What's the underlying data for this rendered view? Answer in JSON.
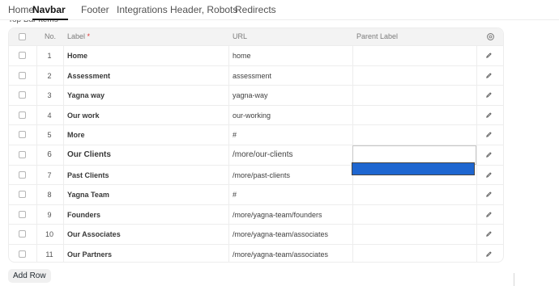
{
  "tabs": [
    {
      "label": "Home"
    },
    {
      "label": "Navbar",
      "active": true
    },
    {
      "label": "Footer"
    },
    {
      "label": "Integrations"
    },
    {
      "label": "Header, Robots"
    },
    {
      "label": "Redirects"
    }
  ],
  "section_label": "Top Bar Items",
  "columns": {
    "no": "No.",
    "label": "Label",
    "required_mark": "*",
    "url": "URL",
    "parent_label": "Parent Label"
  },
  "rows": [
    {
      "no": "1",
      "label": "Home",
      "url": "home",
      "parent": ""
    },
    {
      "no": "2",
      "label": "Assessment",
      "url": "assessment",
      "parent": ""
    },
    {
      "no": "3",
      "label": "Yagna way",
      "url": "yagna-way",
      "parent": ""
    },
    {
      "no": "4",
      "label": "Our work",
      "url": "our-working",
      "parent": ""
    },
    {
      "no": "5",
      "label": "More",
      "url": "#",
      "parent": ""
    },
    {
      "no": "6",
      "label": "Our Clients",
      "url": "/more/our-clients",
      "parent": "",
      "editing": true
    },
    {
      "no": "7",
      "label": "Past Clients",
      "url": "/more/past-clients",
      "parent": ""
    },
    {
      "no": "8",
      "label": "Yagna Team",
      "url": "#",
      "parent": ""
    },
    {
      "no": "9",
      "label": "Founders",
      "url": "/more/yagna-team/founders",
      "parent": ""
    },
    {
      "no": "10",
      "label": "Our Associates",
      "url": "/more/yagna-team/associates",
      "parent": ""
    },
    {
      "no": "11",
      "label": "Our Partners",
      "url": "/more/yagna-team/associates",
      "parent": ""
    }
  ],
  "add_row_label": "Add Row",
  "colors": {
    "accent": "#1e66d0",
    "border": "#ededed",
    "header_bg": "#f3f3f3"
  },
  "icons": {
    "settings": "gear-icon",
    "edit": "pencil-icon"
  }
}
